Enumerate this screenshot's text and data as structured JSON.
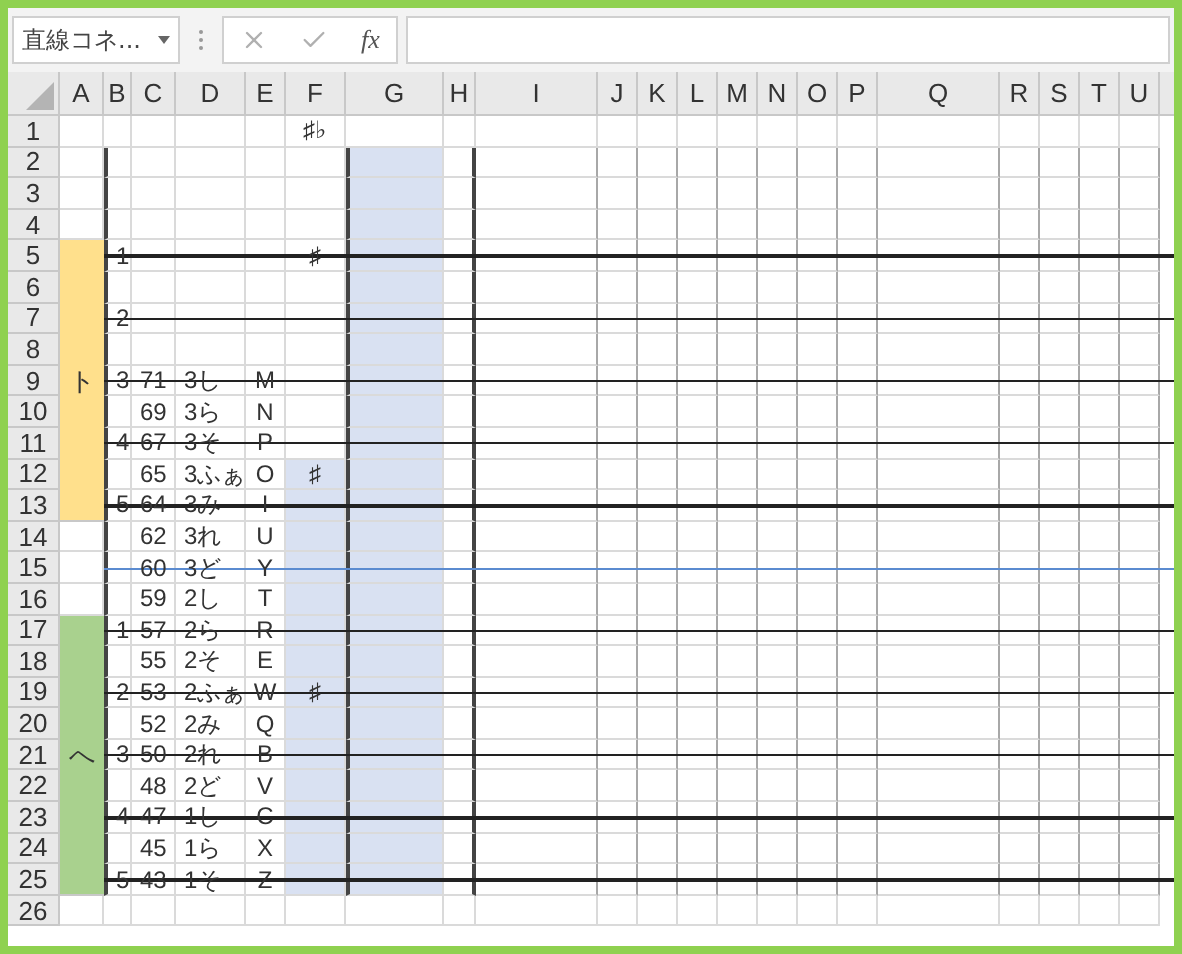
{
  "name_box": {
    "value": "直線コネ..."
  },
  "formula_bar": {
    "function_label": "fx"
  },
  "columns": [
    "A",
    "B",
    "C",
    "D",
    "E",
    "F",
    "G",
    "H",
    "I",
    "J",
    "K",
    "L",
    "M",
    "N",
    "O",
    "P",
    "Q",
    "R",
    "S",
    "T",
    "U"
  ],
  "rows": [
    {
      "number": "1",
      "kind": "plain",
      "f_filled": false,
      "g_filled": false,
      "cells": {
        "f": "♯♭"
      }
    },
    {
      "number": "2",
      "kind": "plain",
      "f_filled": false,
      "g_filled": true
    },
    {
      "number": "3",
      "kind": "plain",
      "f_filled": false,
      "g_filled": true
    },
    {
      "number": "4",
      "kind": "plain",
      "f_filled": false,
      "g_filled": true
    },
    {
      "number": "5",
      "kind": "bold_line",
      "color": "#ffe08c",
      "f_filled": false,
      "g_filled": true,
      "cells": {
        "b": "1",
        "f": "♯"
      }
    },
    {
      "number": "6",
      "kind": "plain",
      "color": "#ffe08c",
      "f_filled": false,
      "g_filled": true
    },
    {
      "number": "7",
      "kind": "bold_line",
      "color": "#ffe08c",
      "f_filled": false,
      "g_filled": true,
      "cells": {
        "b": "2"
      }
    },
    {
      "number": "8",
      "kind": "plain",
      "color": "#ffe08c",
      "f_filled": false,
      "g_filled": true
    },
    {
      "number": "9",
      "kind": "bold_line",
      "color": "#ffe08c",
      "f_filled": false,
      "g_filled": true,
      "cells": {
        "a": "ト",
        "b": "3",
        "c": "71",
        "d": "3し",
        "e": "M"
      }
    },
    {
      "number": "10",
      "kind": "plain",
      "color": "#ffe08c",
      "f_filled": false,
      "g_filled": true,
      "cells": {
        "c": "69",
        "d": "3ら",
        "e": "N"
      }
    },
    {
      "number": "11",
      "kind": "bold_line",
      "color": "#ffe08c",
      "f_filled": false,
      "g_filled": true,
      "cells": {
        "b": "4",
        "c": "67",
        "d": "3そ",
        "e": "P"
      }
    },
    {
      "number": "12",
      "kind": "plain",
      "color": "#ffe08c",
      "f_filled": true,
      "g_filled": true,
      "cells": {
        "c": "65",
        "d": "3ふぁ",
        "e": "O",
        "f": "♯"
      }
    },
    {
      "number": "13",
      "kind": "bold_line",
      "color": "#ffe08c",
      "f_filled": true,
      "g_filled": true,
      "cells": {
        "b": "5",
        "c": "64",
        "d": "3み",
        "e": "I"
      }
    },
    {
      "number": "14",
      "kind": "plain",
      "f_filled": true,
      "g_filled": true,
      "cells": {
        "c": "62",
        "d": "3れ",
        "e": "U"
      }
    },
    {
      "number": "15",
      "kind": "thin_line",
      "f_filled": true,
      "g_filled": true,
      "cells": {
        "c": "60",
        "d": "3ど",
        "e": "Y"
      }
    },
    {
      "number": "16",
      "kind": "plain",
      "f_filled": true,
      "g_filled": true,
      "cells": {
        "c": "59",
        "d": "2し",
        "e": "T"
      }
    },
    {
      "number": "17",
      "kind": "bold_line",
      "color": "#a9d18e",
      "f_filled": true,
      "g_filled": true,
      "cells": {
        "b": "1",
        "c": "57",
        "d": "2ら",
        "e": "R"
      }
    },
    {
      "number": "18",
      "kind": "plain",
      "color": "#a9d18e",
      "f_filled": true,
      "g_filled": true,
      "cells": {
        "c": "55",
        "d": "2そ",
        "e": "E"
      }
    },
    {
      "number": "19",
      "kind": "bold_line",
      "color": "#a9d18e",
      "f_filled": true,
      "g_filled": true,
      "cells": {
        "b": "2",
        "c": "53",
        "d": "2ふぁ",
        "e": "W",
        "f": "♯"
      }
    },
    {
      "number": "20",
      "kind": "plain",
      "color": "#a9d18e",
      "f_filled": true,
      "g_filled": true,
      "cells": {
        "c": "52",
        "d": "2み",
        "e": "Q"
      }
    },
    {
      "number": "21",
      "kind": "bold_line",
      "color": "#a9d18e",
      "f_filled": true,
      "g_filled": true,
      "cells": {
        "a": "へ",
        "b": "3",
        "c": "50",
        "d": "2れ",
        "e": "B"
      }
    },
    {
      "number": "22",
      "kind": "plain",
      "color": "#a9d18e",
      "f_filled": true,
      "g_filled": true,
      "cells": {
        "c": "48",
        "d": "2ど",
        "e": "V"
      }
    },
    {
      "number": "23",
      "kind": "bold_line",
      "color": "#a9d18e",
      "f_filled": true,
      "g_filled": true,
      "cells": {
        "b": "4",
        "c": "47",
        "d": "1し",
        "e": "C"
      }
    },
    {
      "number": "24",
      "kind": "plain",
      "color": "#a9d18e",
      "f_filled": true,
      "g_filled": true,
      "cells": {
        "c": "45",
        "d": "1ら",
        "e": "X"
      }
    },
    {
      "number": "25",
      "kind": "bold_line",
      "color": "#a9d18e",
      "f_filled": true,
      "g_filled": true,
      "cells": {
        "b": "5",
        "c": "43",
        "d": "1そ",
        "e": "Z"
      }
    },
    {
      "number": "26",
      "kind": "plain",
      "f_filled": false,
      "g_filled": false
    }
  ]
}
